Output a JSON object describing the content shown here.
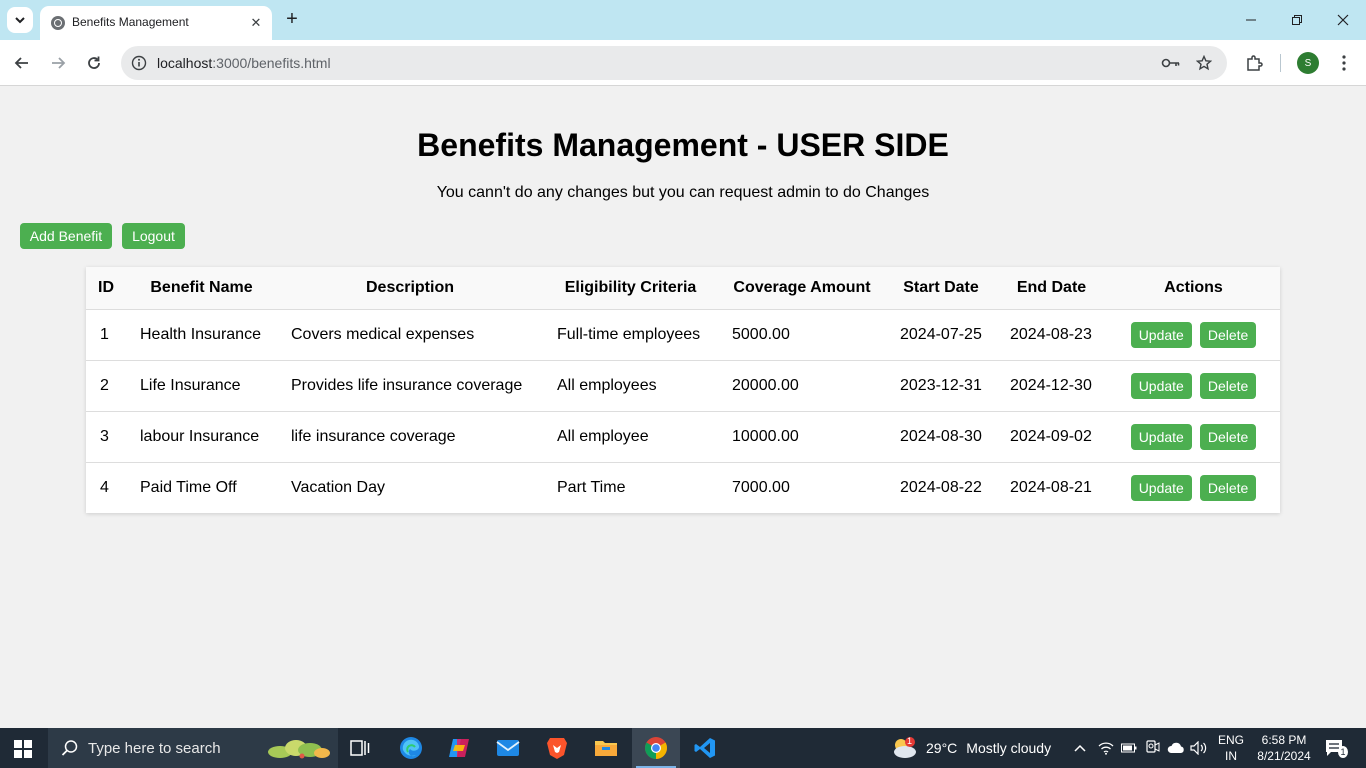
{
  "browser": {
    "tab_title": "Benefits Management",
    "url_host": "localhost",
    "url_path": ":3000/benefits.html",
    "profile_initial": "S"
  },
  "page": {
    "title": "Benefits Management - USER SIDE",
    "subtitle": "You cann't do any changes but you can request admin to do Changes",
    "add_button": "Add Benefit",
    "logout_button": "Logout"
  },
  "table": {
    "headers": [
      "ID",
      "Benefit Name",
      "Description",
      "Eligibility Criteria",
      "Coverage Amount",
      "Start Date",
      "End Date",
      "Actions"
    ],
    "rows": [
      {
        "id": "1",
        "name": "Health Insurance",
        "description": "Covers medical expenses",
        "eligibility": "Full-time employees",
        "amount": "5000.00",
        "start": "2024-07-25",
        "end": "2024-08-23"
      },
      {
        "id": "2",
        "name": "Life Insurance",
        "description": "Provides life insurance coverage",
        "eligibility": "All employees",
        "amount": "20000.00",
        "start": "2023-12-31",
        "end": "2024-12-30"
      },
      {
        "id": "3",
        "name": "labour Insurance",
        "description": "life insurance coverage",
        "eligibility": "All employee",
        "amount": "10000.00",
        "start": "2024-08-30",
        "end": "2024-09-02"
      },
      {
        "id": "4",
        "name": "Paid Time Off",
        "description": "Vacation Day",
        "eligibility": "Part Time",
        "amount": "7000.00",
        "start": "2024-08-22",
        "end": "2024-08-21"
      }
    ],
    "update_label": "Update",
    "delete_label": "Delete"
  },
  "taskbar": {
    "search_placeholder": "Type here to search",
    "weather_temp": "29°C",
    "weather_text": "Mostly cloudy",
    "weather_badge": "1",
    "lang_line1": "ENG",
    "lang_line2": "IN",
    "time": "6:58 PM",
    "date": "8/21/2024",
    "notification_count": "1"
  },
  "colors": {
    "button_green": "#4caf50",
    "tabbar_bg": "#bfe6f2",
    "taskbar_bg": "#1f2a36"
  }
}
